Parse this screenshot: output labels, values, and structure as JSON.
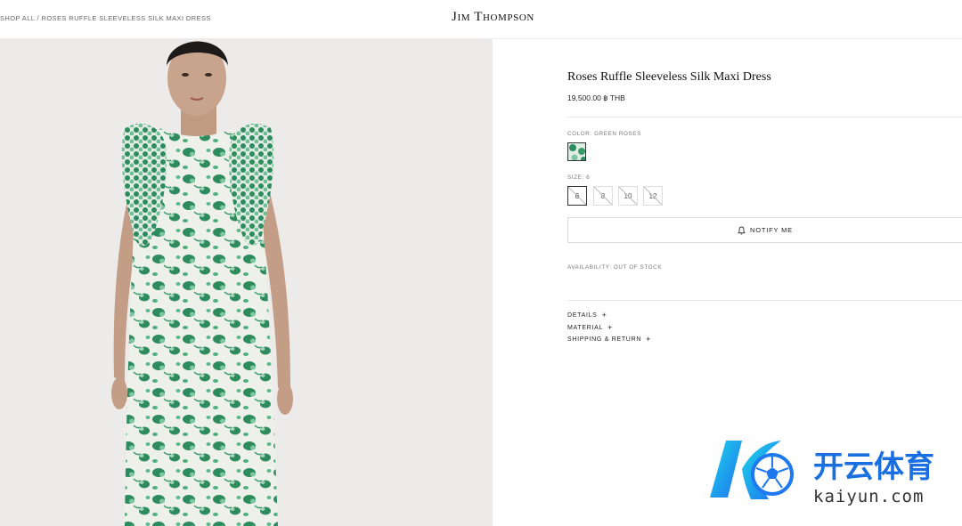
{
  "breadcrumb": "SHOP ALL / ROSES RUFFLE SLEEVELESS SILK MAXI DRESS",
  "brand": "Jim Thompson",
  "product": {
    "title": "Roses Ruffle Sleeveless Silk Maxi Dress",
    "price": "19,500.00 ฿ THB",
    "color_label": "COLOR: GREEN ROSES",
    "size_label": "SIZE: 6",
    "sizes": [
      "6",
      "8",
      "10",
      "12"
    ],
    "notify_label": "NOTIFY ME",
    "availability": "AVAILABILITY: OUT OF STOCK"
  },
  "accordion": {
    "details": "DETAILS",
    "material": "MATERIAL",
    "shipping": "SHIPPING & RETURN",
    "expand_symbol": "+"
  },
  "watermark": {
    "chinese": "开云体育",
    "domain": "kaiyun.com"
  },
  "colors": {
    "print_green": "#2e8b5e",
    "print_light": "#7fc6a0",
    "print_base": "#eef1ea",
    "gallery_bg": "#ecebe9",
    "watermark_blue": "#1e8ff0"
  },
  "icons": {
    "notify": "bell-icon",
    "size_unavailable": "strike-icon",
    "watermark_logo": "soccer-ball-icon"
  }
}
